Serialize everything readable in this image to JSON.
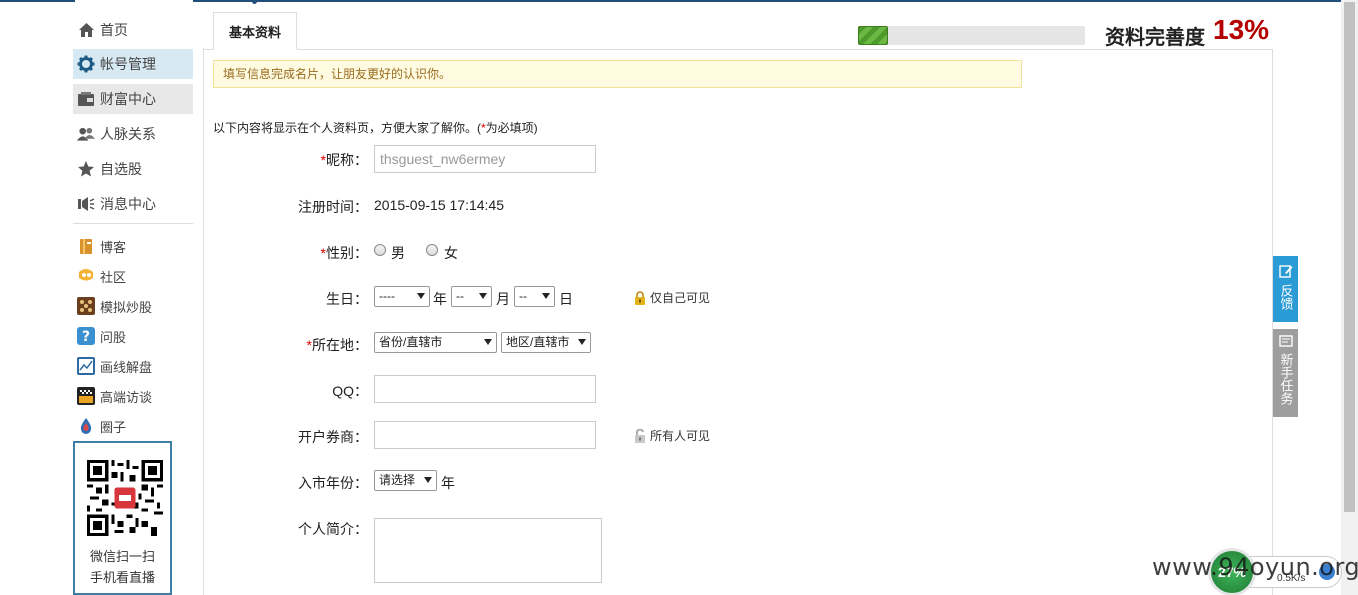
{
  "sidebar": {
    "main_items": [
      {
        "label": "首页",
        "icon": "home-icon"
      },
      {
        "label": "帐号管理",
        "icon": "gear-icon"
      },
      {
        "label": "财富中心",
        "icon": "wallet-icon"
      },
      {
        "label": "人脉关系",
        "icon": "people-icon"
      },
      {
        "label": "自选股",
        "icon": "star-icon"
      },
      {
        "label": "消息中心",
        "icon": "speaker-icon"
      }
    ],
    "sub_items": [
      {
        "label": "博客",
        "icon": "blog-icon"
      },
      {
        "label": "社区",
        "icon": "community-icon"
      },
      {
        "label": "模拟炒股",
        "icon": "chess-icon"
      },
      {
        "label": "问股",
        "icon": "question-icon"
      },
      {
        "label": "画线解盘",
        "icon": "chart-draw-icon"
      },
      {
        "label": "高端访谈",
        "icon": "interview-icon"
      },
      {
        "label": "圈子",
        "icon": "drop-icon"
      }
    ],
    "qr": {
      "line1": "微信扫一扫",
      "line2": "手机看直播"
    }
  },
  "tabs": {
    "basic": "基本资料"
  },
  "completeness": {
    "label": "资料完善度",
    "value": "13%",
    "percent": 13
  },
  "notice": "填写信息完成名片，让朋友更好的认识你。",
  "intro": {
    "text": "以下内容将显示在个人资料页，方便大家了解你。(",
    "star": "*",
    "tail": "为必填项)"
  },
  "form": {
    "nickname_label": "昵称：",
    "nickname_value": "thsguest_nw6ermey",
    "regtime_label": "注册时间：",
    "regtime_value": "2015-09-15 17:14:45",
    "gender_label": "性别：",
    "gender_male": "男",
    "gender_female": "女",
    "birthday_label": "生日：",
    "birth_year": "----",
    "birth_month": "--",
    "birth_day": "--",
    "unit_year": "年",
    "unit_month": "月",
    "unit_day": "日",
    "privacy_self": "仅自己可见",
    "location_label": "所在地：",
    "province": "省份/直辖市",
    "district": "地区/直辖市",
    "qq_label": "QQ：",
    "broker_label": "开户券商：",
    "privacy_all": "所有人可见",
    "market_year_label": "入市年份：",
    "market_year_value": "请选择",
    "market_year_unit": "年",
    "bio_label": "个人简介：",
    "required_star": "*"
  },
  "float": {
    "feedback": "反馈",
    "tasks": "新手任务"
  },
  "net_widget": {
    "percent": "27%",
    "speed": "0.5K/s"
  },
  "watermark": "www.94oyun.org",
  "colors": {
    "accent": "#2b9bd6",
    "completeness": "#b30000",
    "progress": "#5aa832",
    "notice_bg": "#fffbe0"
  }
}
